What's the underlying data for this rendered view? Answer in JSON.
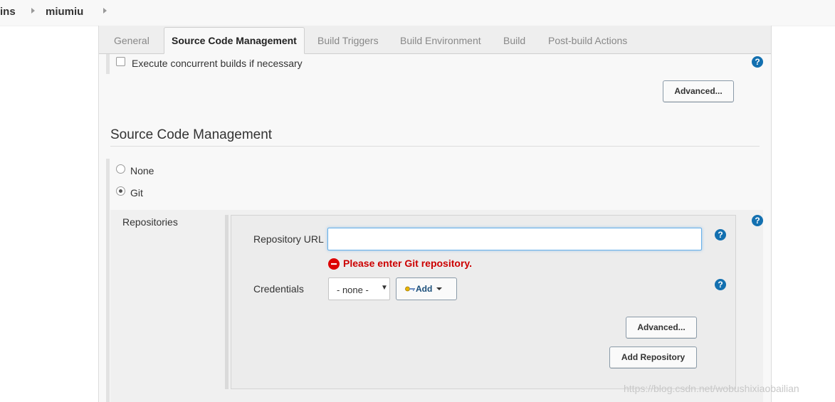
{
  "breadcrumb": {
    "items": [
      "ins",
      "miumiu"
    ]
  },
  "tabs": [
    {
      "label": "General",
      "active": false
    },
    {
      "label": "Source Code Management",
      "active": true
    },
    {
      "label": "Build Triggers",
      "active": false
    },
    {
      "label": "Build Environment",
      "active": false
    },
    {
      "label": "Build",
      "active": false
    },
    {
      "label": "Post-build Actions",
      "active": false
    }
  ],
  "general": {
    "concurrent_label": "Execute concurrent builds if necessary",
    "concurrent_checked": false,
    "advanced_label": "Advanced..."
  },
  "scm": {
    "title": "Source Code Management",
    "options": [
      {
        "label": "None",
        "selected": false
      },
      {
        "label": "Git",
        "selected": true
      }
    ],
    "repositories_label": "Repositories",
    "repository_url_label": "Repository URL",
    "repository_url_value": "",
    "error_message": "Please enter Git repository.",
    "credentials_label": "Credentials",
    "credentials_selected": "- none -",
    "add_label": "Add",
    "advanced_label": "Advanced...",
    "add_repository_label": "Add Repository"
  },
  "help_icon_text": "?",
  "select_arrow": "▼",
  "watermark": "https://blog.csdn.net/wobushixiaobailian",
  "colors": {
    "help_blue": "#1370b0",
    "error_red": "#cc0000",
    "input_focus": "#66afe9"
  }
}
